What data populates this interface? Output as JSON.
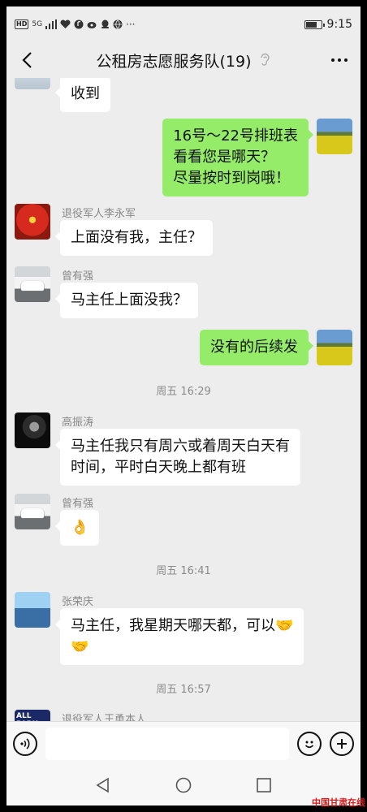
{
  "status_bar": {
    "network_chip": "HD",
    "signal_text": "5G",
    "time": "9:15",
    "battery_level": 0.8
  },
  "header": {
    "title": "公租房志愿服务队(19)"
  },
  "messages": [
    {
      "side": "in",
      "text": "收到"
    },
    {
      "side": "out",
      "text": "16号～22号排班表\n看看您是哪天？\n尽量按时到岗哦！"
    },
    {
      "side": "in",
      "sender": "退役军人李永军",
      "text": "上面没有我，主任？"
    },
    {
      "side": "in",
      "sender": "曾有强",
      "text": "马主任上面没我？"
    },
    {
      "side": "out",
      "text": "没有的后续发"
    },
    {
      "timestamp": "周五 16:29"
    },
    {
      "side": "in",
      "sender": "高振涛",
      "text": "马主任我只有周六或着周天白天有\n时间，平时白天晚上都有班"
    },
    {
      "side": "in",
      "sender": "曾有强",
      "text": "👌"
    },
    {
      "timestamp": "周五 16:41"
    },
    {
      "side": "in",
      "sender": "张荣庆",
      "text": "马主任，我星期天哪天都，可以🤝\n🤝"
    },
    {
      "timestamp": "周五 16:57"
    },
    {
      "side": "in",
      "sender": "退役军人王勇本人"
    }
  ],
  "input": {
    "placeholder": ""
  },
  "watermark": "中国甘肃在线",
  "icons": {
    "back": "back-arrow-icon",
    "ear": "ear-icon",
    "more": "more-dots-icon",
    "voice": "voice-icon",
    "emoji": "emoji-icon",
    "plus": "plus-icon",
    "nav_back": "nav-back-icon",
    "nav_home": "nav-home-icon",
    "nav_recent": "nav-recent-icon"
  }
}
